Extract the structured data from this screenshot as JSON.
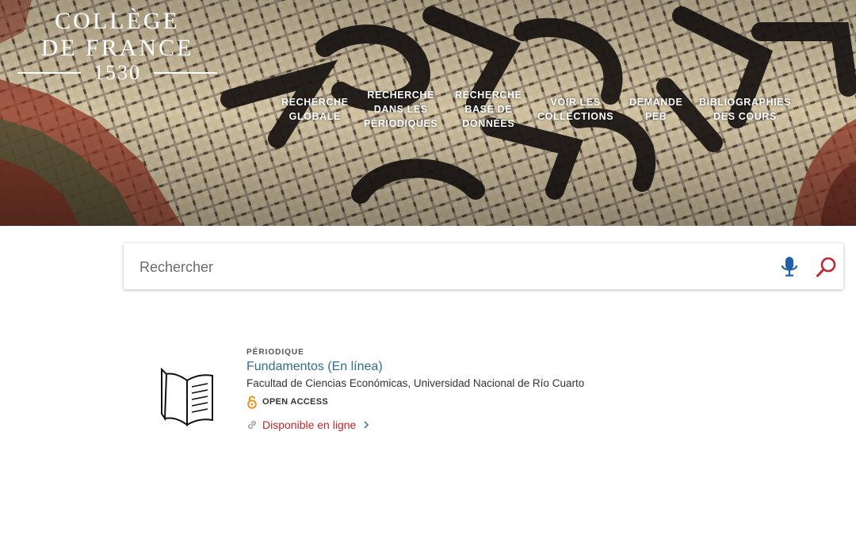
{
  "header": {
    "logo": {
      "line1": "COLLÈGE",
      "line2": "DE FRANCE",
      "year": "1530"
    },
    "nav": [
      {
        "lines": [
          "RECHERCHE",
          "GLOBALE"
        ]
      },
      {
        "lines": [
          "RECHERCHE",
          "DANS LES",
          "PÉRIODIQUES"
        ]
      },
      {
        "lines": [
          "RECHERCHE",
          "BASE DE",
          "DONNÉES"
        ]
      },
      {
        "lines": [
          "VOIR LES",
          "COLLECTIONS"
        ]
      },
      {
        "lines": [
          "DEMANDE",
          "PEB"
        ]
      },
      {
        "lines": [
          "BIBLIOGRAPHIES",
          "DES COURS"
        ]
      }
    ]
  },
  "search": {
    "placeholder": "Rechercher"
  },
  "colors": {
    "title_link": "#2d6f8f",
    "availability_link": "#c0282d",
    "search_icon": "#c0282d",
    "mic_icon": "#1f5fa8",
    "open_access_icon": "#e7931d"
  },
  "result": {
    "type": "PÉRIODIQUE",
    "title": "Fundamentos (En línea)",
    "publisher": "Facultad de Ciencias Económicas, Universidad Nacional de Río Cuarto",
    "open_access": "OPEN ACCESS",
    "availability": "Disponible en ligne",
    "icons": [
      "book-icon",
      "open-access-lock-icon",
      "link-icon",
      "chevron-right-icon"
    ]
  }
}
